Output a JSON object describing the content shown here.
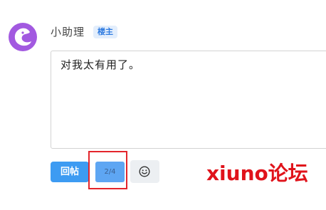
{
  "post": {
    "username": "小助理",
    "badge": "楼主"
  },
  "reply": {
    "text": "对我太有用了。"
  },
  "toolbar": {
    "reply_label": "回帖",
    "page_indicator": "2/4",
    "emoji_icon": "smiley-icon"
  },
  "watermark": {
    "text": "xiuno论坛"
  },
  "colors": {
    "avatar": "#a259e0",
    "badge_text": "#2f7be0",
    "badge_bg": "#e3eefc",
    "reply_button": "#3d9bf2",
    "page_indicator": "#5ea6f3",
    "highlight_frame": "#e3252c",
    "watermark": "#e0131b"
  }
}
